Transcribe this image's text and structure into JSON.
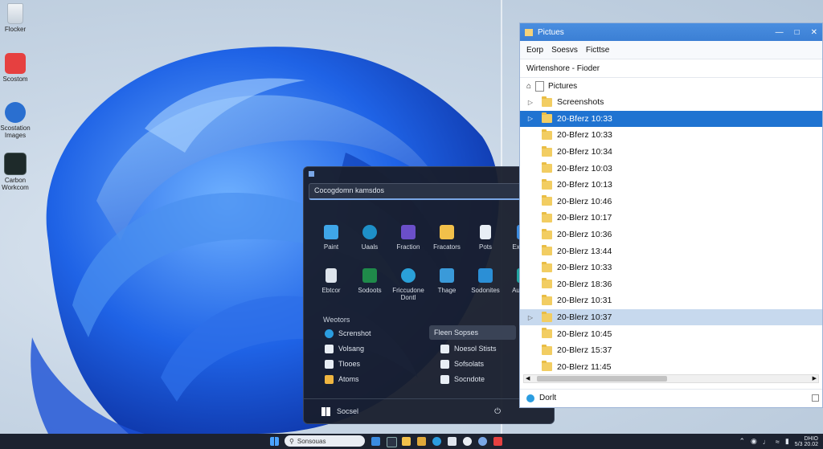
{
  "desktop": {
    "icons": [
      {
        "label": "Flocker",
        "icon": "recycle-bin-icon",
        "color": "#dfe6ee"
      },
      {
        "label": "Scostom",
        "icon": "red-app-icon",
        "color": "#e64040"
      },
      {
        "label": "Scostation Images",
        "icon": "blue-app-icon",
        "color": "#2a6fd0"
      },
      {
        "label": "Carbon Workcom",
        "icon": "dark-app-icon",
        "color": "#1e2a2a"
      }
    ]
  },
  "start_menu": {
    "search_placeholder": "Cocogdomn kamsdos",
    "pinned": [
      {
        "label": "Paint",
        "icon": "paint-icon",
        "color": "#3fa6e8"
      },
      {
        "label": "Uaals",
        "icon": "edge-icon",
        "color": "#1e90c8"
      },
      {
        "label": "Fraction",
        "icon": "purple-app-icon",
        "color": "#6b4fc9"
      },
      {
        "label": "Fracators",
        "icon": "folder-icon",
        "color": "#f2c04a"
      },
      {
        "label": "Pots",
        "icon": "document-icon",
        "color": "#e8eef5"
      },
      {
        "label": "Expeser",
        "icon": "photos-icon",
        "color": "#3b8be0"
      },
      {
        "label": "Ebtcor",
        "icon": "recycle-icon",
        "color": "#dde4ec"
      },
      {
        "label": "Sodoots",
        "icon": "excel-icon",
        "color": "#1f8a4a"
      },
      {
        "label": "Friccudone Dontl",
        "icon": "edge-icon",
        "color": "#2aa0d8"
      },
      {
        "label": "Thage",
        "icon": "image-icon",
        "color": "#3a9ad9"
      },
      {
        "label": "Sodonites",
        "icon": "store-icon",
        "color": "#2b8fd6"
      },
      {
        "label": "Audootd",
        "icon": "arrow-app-icon",
        "color": "#22a3a0"
      }
    ],
    "recommended_title": "Weotors",
    "recommended_left": [
      {
        "label": "Screnshot",
        "icon": "edge-icon",
        "color": "#2b9de0"
      },
      {
        "label": "Volsang",
        "icon": "doc-icon",
        "color": "#e8eef5"
      },
      {
        "label": "Tlooes",
        "icon": "doc-icon",
        "color": "#e8eef5"
      },
      {
        "label": "Atoms",
        "icon": "gem-icon",
        "color": "#f0b640"
      }
    ],
    "recommended_right": [
      {
        "label": "Fleen Sopses",
        "icon": "",
        "color": ""
      },
      {
        "label": "Noesol Stists",
        "icon": "doc-icon",
        "color": "#e8eef5"
      },
      {
        "label": "Sofsolats",
        "icon": "doc-icon",
        "color": "#e8eef5"
      },
      {
        "label": "Socndote",
        "icon": "doc-icon",
        "color": "#e8eef5"
      }
    ],
    "user_label": "Socsel"
  },
  "explorer": {
    "title": "Pictues",
    "menu": [
      "Eorp",
      "Soesvs",
      "Ficttse"
    ],
    "breadcrumb": "Wirtenshore - Fioder",
    "root": "Pictures",
    "items": [
      {
        "label": "Screenshots",
        "state": ""
      },
      {
        "label": "20-Bferz 10:33",
        "state": "selected"
      },
      {
        "label": "20-Bferz 10:33",
        "state": ""
      },
      {
        "label": "20-Bferz 10:34",
        "state": ""
      },
      {
        "label": "20-Bferz 10:03",
        "state": ""
      },
      {
        "label": "20-Bferz 10:13",
        "state": ""
      },
      {
        "label": "20-Blerz 10:46",
        "state": ""
      },
      {
        "label": "20-Blerz 10:17",
        "state": ""
      },
      {
        "label": "20-Blerz 10:36",
        "state": ""
      },
      {
        "label": "20-Blerz 13:44",
        "state": ""
      },
      {
        "label": "20-Blerz 10:33",
        "state": ""
      },
      {
        "label": "20-Blerz 18:36",
        "state": ""
      },
      {
        "label": "20-Blerz 10:31",
        "state": ""
      },
      {
        "label": "20-Blerz 10:37",
        "state": "hover"
      },
      {
        "label": "20-Blerz 10:45",
        "state": ""
      },
      {
        "label": "20-Blerz 15:37",
        "state": ""
      },
      {
        "label": "20-Blerz 11:45",
        "state": ""
      }
    ],
    "status": "Dorlt",
    "scroll_position": 0.05
  },
  "taskbar": {
    "search_text": "Sonsouas",
    "clock_time": "DHIO",
    "clock_date": "5/3 20.02"
  }
}
